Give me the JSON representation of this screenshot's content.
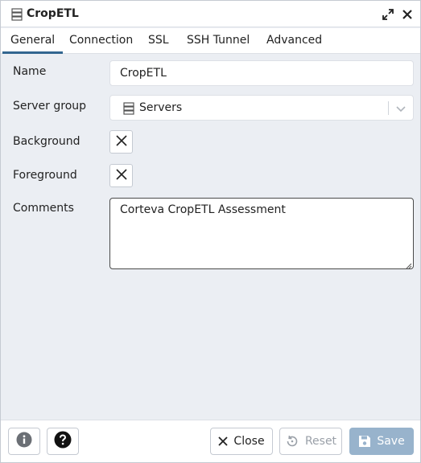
{
  "dialog": {
    "title": "CropETL",
    "icon": "server-icon"
  },
  "tabs": [
    {
      "label": "General",
      "active": true
    },
    {
      "label": "Connection",
      "active": false
    },
    {
      "label": "SSL",
      "active": false
    },
    {
      "label": "SSH Tunnel",
      "active": false
    },
    {
      "label": "Advanced",
      "active": false
    }
  ],
  "form": {
    "name": {
      "label": "Name",
      "value": "CropETL"
    },
    "server_group": {
      "label": "Server group",
      "value": "Servers",
      "icon": "server-group-icon"
    },
    "background": {
      "label": "Background",
      "value_icon": "x-icon"
    },
    "foreground": {
      "label": "Foreground",
      "value_icon": "x-icon"
    },
    "comments": {
      "label": "Comments",
      "value": "Corteva CropETL Assessment"
    }
  },
  "footer": {
    "info_icon": "info-icon",
    "help_icon": "help-icon",
    "close_label": "Close",
    "reset_label": "Reset",
    "save_label": "Save"
  },
  "colors": {
    "accent": "#326690",
    "save_bg": "#98b3cc",
    "panel_bg": "#ebeef3",
    "border": "#dde0e6"
  }
}
